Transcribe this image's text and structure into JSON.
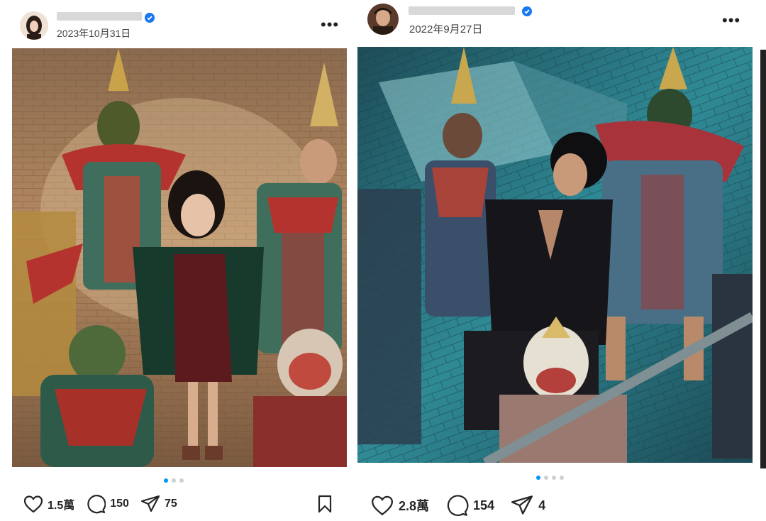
{
  "left_post": {
    "date": "2023年10月31日",
    "more_label": "•••",
    "image_alt": "Woman in green coat and burgundy dress posing among Thai khon dancers in ornate costumes",
    "likes": "1.5萬",
    "comments": "150",
    "shares": "75",
    "carousel_dots": 3,
    "carousel_active": 0
  },
  "right_post": {
    "date": "2022年9月27日",
    "more_label": "•••",
    "image_alt": "Man in black outfit standing among Thai khon dancers in masks on a blue tiled floor",
    "likes": "2.8萬",
    "comments": "154",
    "shares": "4",
    "carousel_dots": 4,
    "carousel_active": 0
  },
  "colors": {
    "verified": "#1877f2",
    "dot_active": "#0095f6",
    "warm_photo": "#a87a4e",
    "cool_photo": "#2f7f8c"
  }
}
